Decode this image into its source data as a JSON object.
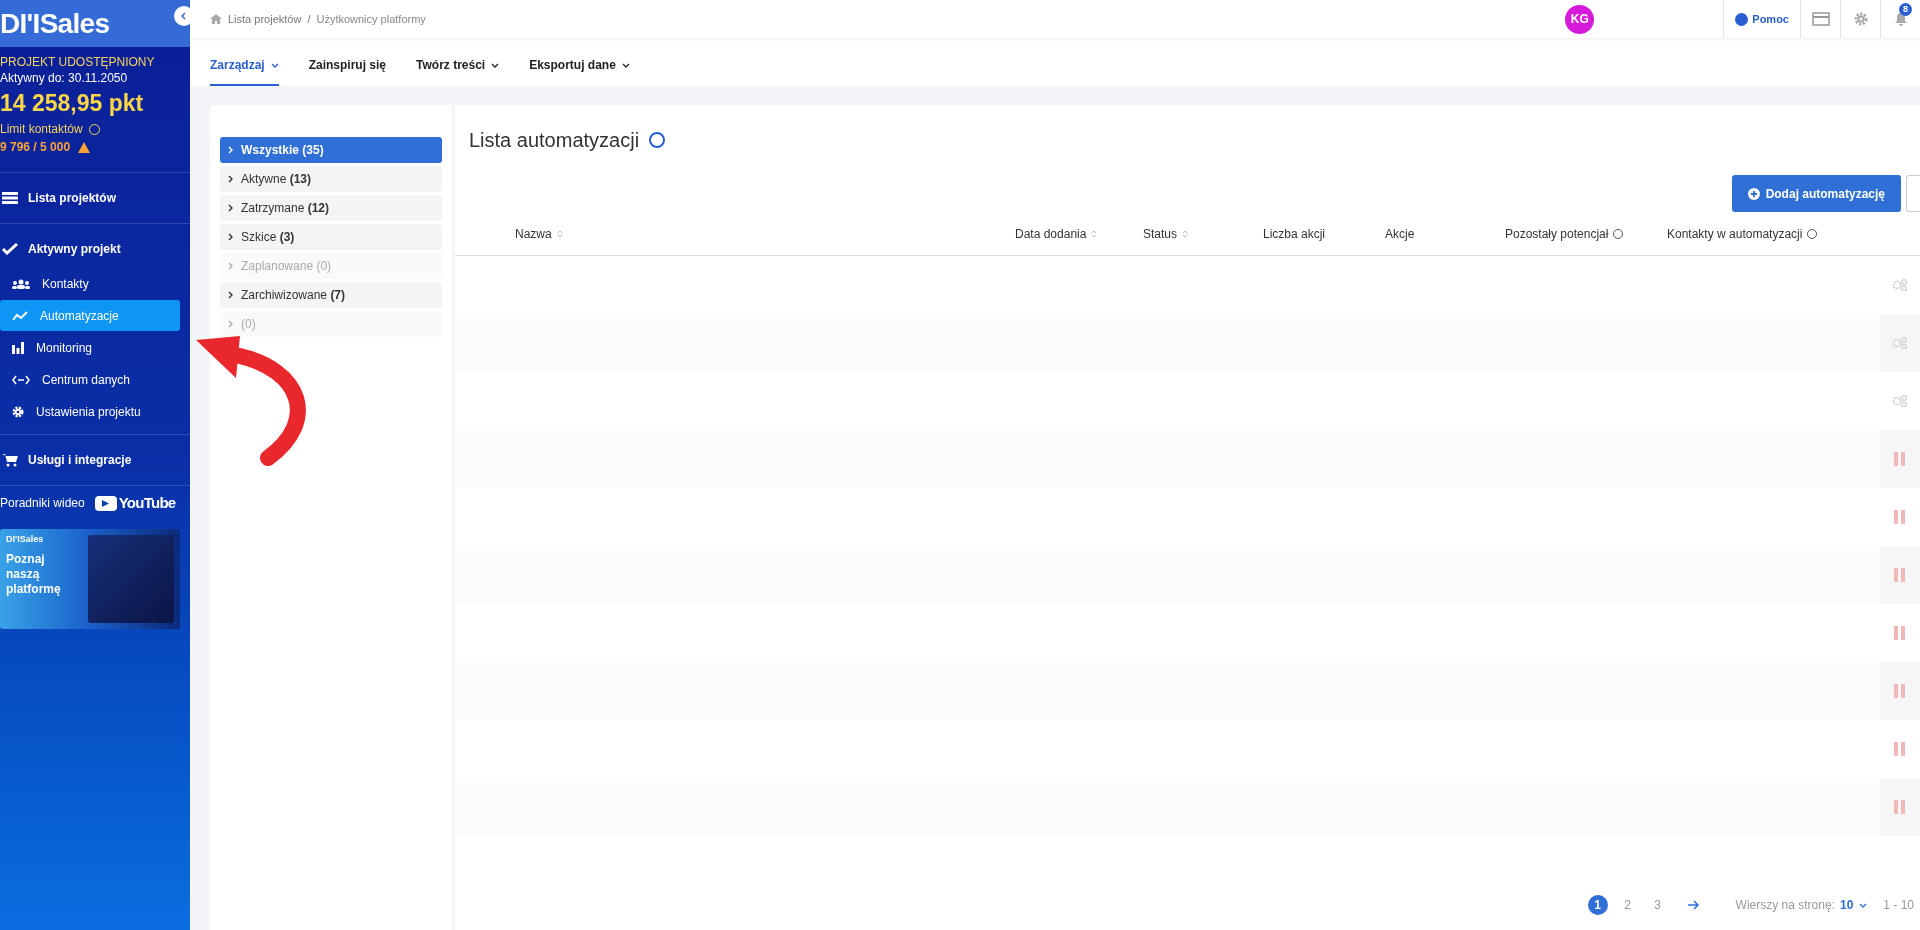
{
  "sidebar": {
    "logo": "DI'ISales",
    "project_status": "PROJEKT UDOSTĘPNIONY",
    "active_until": "Aktywny do: 30.11.2050",
    "points": "14 258,95 pkt",
    "contact_limit_label": "Limit kontaktów",
    "contact_limit_value": "9 796 / 5 000",
    "nav": [
      {
        "kind": "section",
        "label": "Lista projektów",
        "selected": false
      },
      {
        "kind": "section",
        "label": "Aktywny projekt",
        "selected": false
      },
      {
        "kind": "item",
        "label": "Kontakty",
        "selected": false
      },
      {
        "kind": "item",
        "label": "Automatyzacje",
        "selected": true
      },
      {
        "kind": "item",
        "label": "Monitoring",
        "selected": false
      },
      {
        "kind": "item",
        "label": "Centrum danych",
        "selected": false
      },
      {
        "kind": "item",
        "label": "Ustawienia projektu",
        "selected": false
      },
      {
        "kind": "section",
        "label": "Usługi i integracje",
        "selected": false
      }
    ],
    "video_label": "Poradniki wideo",
    "youtube": "YouTube",
    "promo": {
      "brand": "DI'ISales",
      "text": "Poznaj naszą platformę"
    }
  },
  "breadcrumb": {
    "items": [
      "Lista projektów",
      "Użytkownicy platformy"
    ],
    "separator": "/"
  },
  "avatar": "KG",
  "help": "Pomoc",
  "notifications": "8",
  "tabs": [
    {
      "label": "Zarządzaj",
      "dropdown": true,
      "selected": true
    },
    {
      "label": "Zainspiruj się",
      "dropdown": false,
      "selected": false
    },
    {
      "label": "Twórz treści",
      "dropdown": true,
      "selected": false
    },
    {
      "label": "Eksportuj dane",
      "dropdown": true,
      "selected": false
    }
  ],
  "filters": [
    {
      "label": "Wszystkie **(35)**",
      "selected": true,
      "disabled": false
    },
    {
      "label": "Aktywne **(13)**",
      "selected": false,
      "disabled": false
    },
    {
      "label": "Zatrzymane **(12)**",
      "selected": false,
      "disabled": false
    },
    {
      "label": "Szkice **(3)**",
      "selected": false,
      "disabled": false
    },
    {
      "label": "Zaplanowane (0)",
      "selected": false,
      "disabled": true
    },
    {
      "label": "Zarchiwizowane **(7)**",
      "selected": false,
      "disabled": false
    },
    {
      "label": "(0)",
      "selected": false,
      "disabled": true
    }
  ],
  "title": "Lista automatyzacji",
  "add_button": "Dodaj automatyzację",
  "table": {
    "columns": [
      {
        "label": "Nazwa",
        "sortable": true,
        "help": false
      },
      {
        "label": "Data dodania",
        "sortable": true,
        "help": false
      },
      {
        "label": "Status",
        "sortable": true,
        "help": false
      },
      {
        "label": "Liczba akcji",
        "sortable": false,
        "help": false
      },
      {
        "label": "Akcje",
        "sortable": false,
        "help": false
      },
      {
        "label": "Pozostały potencjał",
        "sortable": false,
        "help": true
      },
      {
        "label": "Kontakty w automatyzacji",
        "sortable": false,
        "help": true
      }
    ],
    "rows": [
      {
        "kind": "gear"
      },
      {
        "kind": "gear"
      },
      {
        "kind": "gear"
      },
      {
        "kind": "pause"
      },
      {
        "kind": "pause"
      },
      {
        "kind": "pause"
      },
      {
        "kind": "pause"
      },
      {
        "kind": "pause"
      },
      {
        "kind": "pause"
      },
      {
        "kind": "pause"
      }
    ]
  },
  "pagination": {
    "pages": [
      {
        "label": "1",
        "selected": true
      },
      {
        "label": "2",
        "selected": false
      },
      {
        "label": "3",
        "selected": false
      }
    ],
    "rows_label": "Wierszy na stronę:",
    "rows_value": "10",
    "range": "1 - 10"
  }
}
